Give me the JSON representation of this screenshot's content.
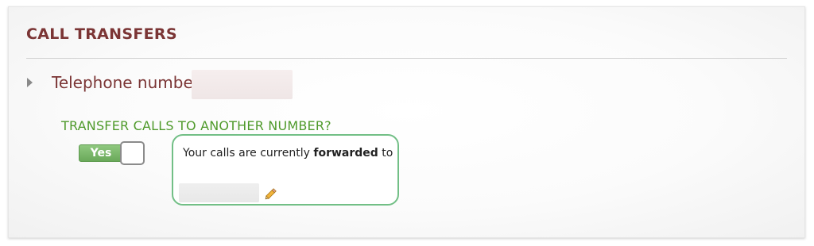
{
  "section": {
    "title": "CALL TRANSFERS"
  },
  "telephone": {
    "label": "Telephone number:",
    "value": ""
  },
  "transfer": {
    "question": "TRANSFER CALLS TO ANOTHER NUMBER?",
    "toggle_label": "Yes",
    "toggle_on": true
  },
  "forwarding": {
    "text_before": "Your calls are currently ",
    "text_emphasis": "forwarded",
    "text_after": " to",
    "number": ""
  },
  "icons": {
    "expand": "triangle-right-icon",
    "edit": "pencil-icon"
  },
  "colors": {
    "title": "#7b3535",
    "accent_green": "#4f9a2b",
    "toggle_green": "#6aa95a",
    "box_border": "#72bf86"
  }
}
